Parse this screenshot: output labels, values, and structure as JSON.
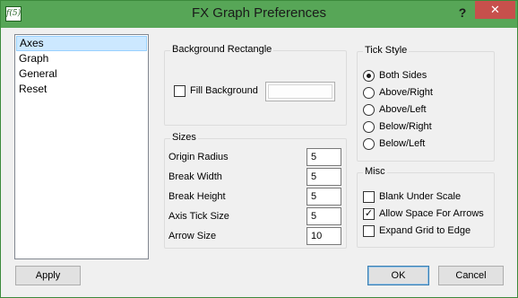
{
  "window": {
    "title": "FX Graph Preferences",
    "app_icon_text": "f(5)",
    "help_label": "?",
    "close_label": "✕"
  },
  "nav": {
    "items": [
      "Axes",
      "Graph",
      "General",
      "Reset"
    ],
    "selected": "Axes"
  },
  "background": {
    "group_title": "Background Rectangle",
    "fill_label": "Fill Background",
    "fill_checked": false
  },
  "sizes": {
    "group_title": "Sizes",
    "rows": [
      {
        "label": "Origin Radius",
        "value": "5"
      },
      {
        "label": "Break Width",
        "value": "5"
      },
      {
        "label": "Break Height",
        "value": "5"
      },
      {
        "label": "Axis Tick Size",
        "value": "5"
      },
      {
        "label": "Arrow Size",
        "value": "10"
      }
    ]
  },
  "tick_style": {
    "group_title": "Tick Style",
    "options": [
      "Both Sides",
      "Above/Right",
      "Above/Left",
      "Below/Right",
      "Below/Left"
    ],
    "selected": "Both Sides"
  },
  "misc": {
    "group_title": "Misc",
    "options": [
      {
        "label": "Blank Under Scale",
        "checked": false
      },
      {
        "label": "Allow Space For Arrows",
        "checked": true
      },
      {
        "label": "Expand Grid to Edge",
        "checked": false
      }
    ]
  },
  "buttons": {
    "apply": "Apply",
    "ok": "OK",
    "cancel": "Cancel"
  },
  "colors": {
    "titlebar": "#57a657",
    "close": "#c7504c",
    "selection": "#cce8ff"
  }
}
